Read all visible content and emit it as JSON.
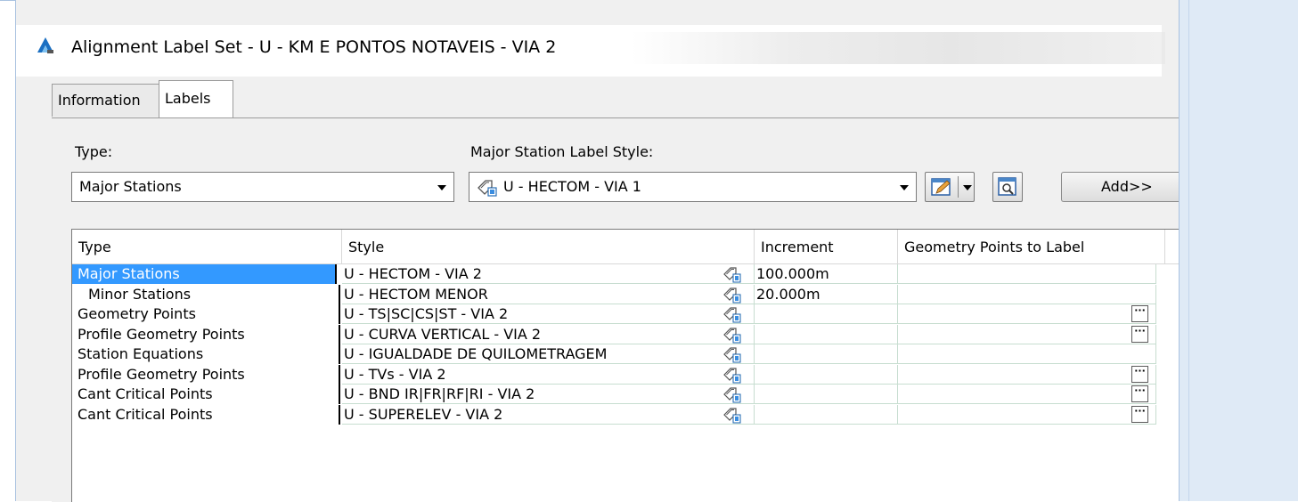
{
  "dialog": {
    "title": "Alignment Label Set - U - KM E PONTOS NOTAVEIS - VIA 2",
    "tabs": [
      {
        "label": "Information",
        "active": false
      },
      {
        "label": "Labels",
        "active": true
      }
    ]
  },
  "controls": {
    "type_label": "Type:",
    "type_value": "Major Stations",
    "style_label": "Major Station Label Style:",
    "style_value": "U - HECTOM - VIA 1",
    "add_label": "Add>>"
  },
  "grid": {
    "columns": [
      "Type",
      "Style",
      "Increment",
      "Geometry Points to Label"
    ],
    "rows": [
      {
        "type": "Major Stations",
        "style": "U - HECTOM - VIA 2",
        "increment": "100.000m",
        "selected": true,
        "indent": false,
        "has_geo_button": false
      },
      {
        "type": "Minor Stations",
        "style": "U - HECTOM MENOR",
        "increment": "20.000m",
        "selected": false,
        "indent": true,
        "has_geo_button": false
      },
      {
        "type": "Geometry Points",
        "style": "U - TS|SC|CS|ST - VIA 2",
        "increment": "",
        "selected": false,
        "indent": false,
        "has_geo_button": true
      },
      {
        "type": "Profile Geometry Points",
        "style": "U - CURVA VERTICAL - VIA 2",
        "increment": "",
        "selected": false,
        "indent": false,
        "has_geo_button": true
      },
      {
        "type": "Station Equations",
        "style": "U - IGUALDADE DE QUILOMETRAGEM",
        "increment": "",
        "selected": false,
        "indent": false,
        "has_geo_button": false
      },
      {
        "type": "Profile Geometry Points",
        "style": "U - TVs - VIA 2",
        "increment": "",
        "selected": false,
        "indent": false,
        "has_geo_button": true
      },
      {
        "type": "Cant Critical Points",
        "style": "U - BND IR|FR|RF|RI - VIA 2",
        "increment": "",
        "selected": false,
        "indent": false,
        "has_geo_button": true
      },
      {
        "type": "Cant Critical Points",
        "style": "U - SUPERELEV - VIA 2",
        "increment": "",
        "selected": false,
        "indent": false,
        "has_geo_button": true
      }
    ],
    "ellipsis": "···"
  },
  "icons": {
    "app": "autocad-civil-icon",
    "style_row": "label-style-icon",
    "edit": "edit-style-icon",
    "details": "style-details-icon"
  },
  "colors": {
    "selection": "#3399ff",
    "dialog_bg": "#f0f0f0",
    "side_panel": "#dfeaf6"
  }
}
